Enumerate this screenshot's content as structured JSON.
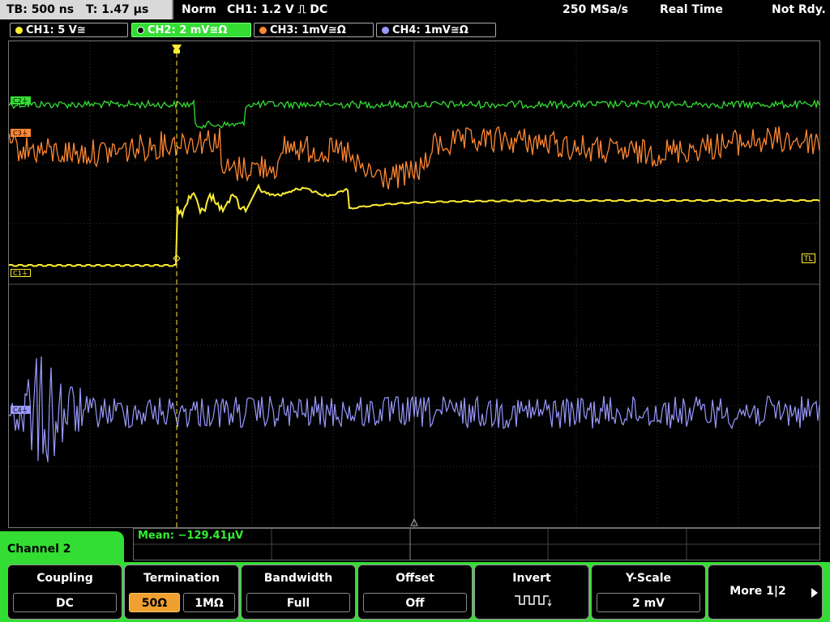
{
  "status": {
    "timebase": "TB: 500 ns",
    "trigger_time": "T: 1.47 µs",
    "mode": "Norm",
    "trigger_info": "CH1: 1.2 V ⎍ DC",
    "sample_rate": "250 MSa/s",
    "acq_mode": "Real Time",
    "state": "Not Rdy."
  },
  "channels": [
    {
      "label": "CH1: 5 V≅",
      "color": "#ffee33"
    },
    {
      "label": "CH2: 2 mV≅Ω",
      "color": "#33dd33"
    },
    {
      "label": "CH3: 1mV≅Ω",
      "color": "#ff8833"
    },
    {
      "label": "CH4: 1mV≅Ω",
      "color": "#9999ff"
    }
  ],
  "grid_labels": {
    "c1": "C1⏚",
    "c2": "C2⏚",
    "c3": "C3⏚",
    "c4": "C4⏚",
    "tl": "TL"
  },
  "measurement": {
    "mean": "Mean: −129.41µV"
  },
  "panel": {
    "title": "Channel 2"
  },
  "menu": {
    "coupling": {
      "title": "Coupling",
      "value": "DC"
    },
    "termination": {
      "title": "Termination",
      "value_50": "50Ω",
      "value_1m": "1MΩ"
    },
    "bandwidth": {
      "title": "Bandwidth",
      "value": "Full"
    },
    "offset": {
      "title": "Offset",
      "value": "Off"
    },
    "invert": {
      "title": "Invert"
    },
    "yscale": {
      "title": "Y-Scale",
      "value": "2 mV"
    },
    "more": {
      "label": "More 1|2"
    }
  },
  "colors": {
    "ch1": "#ffee33",
    "ch2": "#33dd33",
    "ch3": "#ff8833",
    "ch4": "#9999ff",
    "accent": "#33dd33"
  }
}
